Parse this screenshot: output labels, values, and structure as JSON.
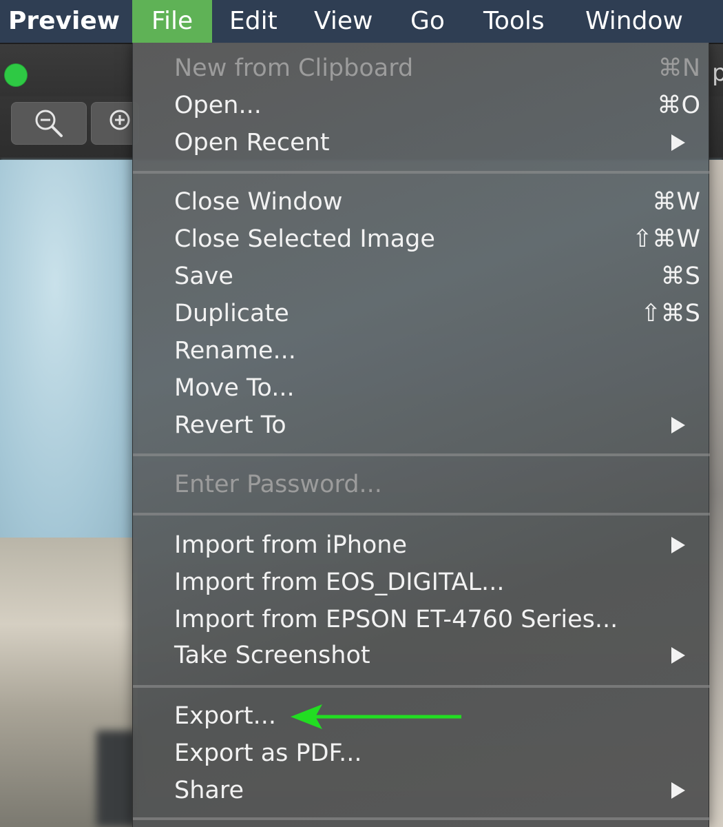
{
  "menubar": {
    "app": "Preview",
    "items": [
      "File",
      "Edit",
      "View",
      "Go",
      "Tools",
      "Window"
    ]
  },
  "window": {
    "peek_text": "p"
  },
  "file_menu": {
    "groups": [
      [
        {
          "label": "New from Clipboard",
          "shortcut": "⌘N",
          "disabled": true
        },
        {
          "label": "Open...",
          "shortcut": "⌘O"
        },
        {
          "label": "Open Recent",
          "submenu": true
        }
      ],
      [
        {
          "label": "Close Window",
          "shortcut": "⌘W"
        },
        {
          "label": "Close Selected Image",
          "shortcut": "⇧⌘W"
        },
        {
          "label": "Save",
          "shortcut": "⌘S"
        },
        {
          "label": "Duplicate",
          "shortcut": "⇧⌘S"
        },
        {
          "label": "Rename..."
        },
        {
          "label": "Move To..."
        },
        {
          "label": "Revert To",
          "submenu": true
        }
      ],
      [
        {
          "label": "Enter Password...",
          "disabled": true
        }
      ],
      [
        {
          "label": "Import from iPhone",
          "submenu": true
        },
        {
          "label": "Import from EOS_DIGITAL..."
        },
        {
          "label": "Import from EPSON ET-4760 Series..."
        },
        {
          "label": "Take Screenshot",
          "submenu": true
        }
      ],
      [
        {
          "label": "Export..."
        },
        {
          "label": "Export as PDF..."
        },
        {
          "label": "Share",
          "submenu": true
        }
      ]
    ]
  },
  "annotation": {
    "arrow_color": "#22dd22",
    "target": "Export..."
  },
  "colors": {
    "menubar_bg": "#2f3e53",
    "active_menu": "#5fb256",
    "zoom_button": "#2ec944"
  }
}
